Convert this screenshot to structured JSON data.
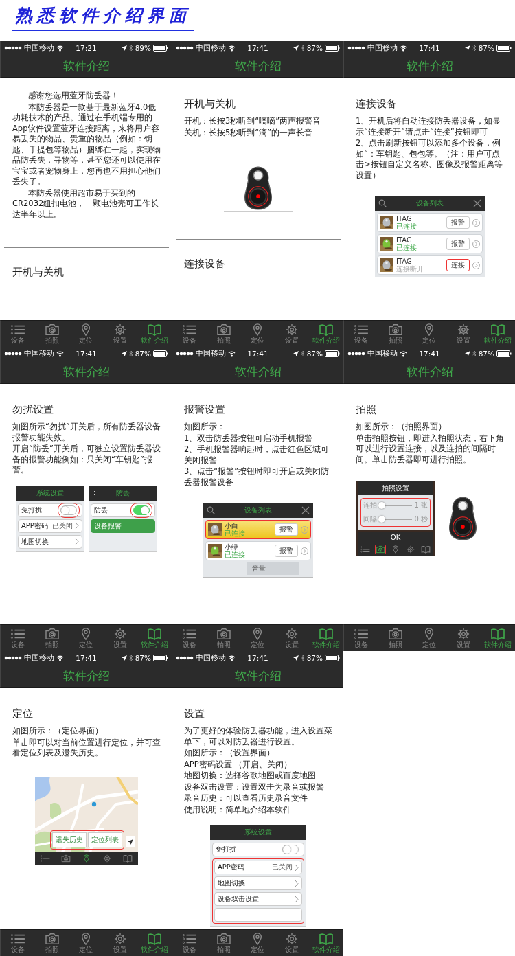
{
  "title": "熟悉软件介绍界面",
  "phones": [
    {
      "carrier": "中国移动",
      "time": "17:21",
      "battery": "89%",
      "header": "软件介绍",
      "blocks": [
        {
          "kind": "para",
          "text": "感谢您选用蓝牙防丢器！"
        },
        {
          "kind": "para",
          "text": "本防丢器是一款基于最新蓝牙4.0低功耗技术的产品。通过在手机端专用的App软件设置蓝牙连接距离，来将用户容易丢失的物品、贵重的物品（例如：钥匙、手提包等物品）捆绑在一起，实现物品防丢失，寻物等，甚至您还可以使用在宝宝或者宠物身上，您再也不用担心他们丢失了。"
        },
        {
          "kind": "para",
          "text": "本防丢器使用超市易于买到的CR2032纽扣电池，一颗电池壳可工作长达半年以上。"
        },
        {
          "kind": "rule"
        },
        {
          "kind": "heading",
          "text": "开机与关机"
        }
      ],
      "tabs": [
        {
          "label": "设备",
          "selected": false
        },
        {
          "label": "拍照",
          "selected": false
        },
        {
          "label": "定位",
          "selected": false
        },
        {
          "label": "设置",
          "selected": false
        },
        {
          "label": "软件介绍",
          "selected": true
        }
      ]
    },
    {
      "carrier": "中国移动",
      "time": "17:41",
      "battery": "87%",
      "header": "软件介绍",
      "blocks": [
        {
          "kind": "heading",
          "text": "开机与关机"
        },
        {
          "kind": "text",
          "text": "开机：长按3秒听到“嘀嘀”两声报警音"
        },
        {
          "kind": "text",
          "text": "关机：长按5秒听到“滴”的一声长音"
        },
        {
          "kind": "tag"
        },
        {
          "kind": "rule"
        },
        {
          "kind": "heading",
          "text": "连接设备"
        }
      ],
      "tabs": [
        {
          "label": "设备",
          "selected": false
        },
        {
          "label": "拍照",
          "selected": false
        },
        {
          "label": "定位",
          "selected": false
        },
        {
          "label": "设置",
          "selected": false
        },
        {
          "label": "软件介绍",
          "selected": true
        }
      ]
    },
    {
      "carrier": "中国移动",
      "time": "17:41",
      "battery": "87%",
      "header": "软件介绍",
      "blocks": [
        {
          "kind": "heading",
          "text": "连接设备"
        },
        {
          "kind": "text",
          "text": "1、开机后将自动连接防丢器设备，如显示“连接断开”请点击“连接”按钮即可"
        },
        {
          "kind": "text",
          "text": "2、点击刷新按钮可以添加多个设备，例如“：车钥匙、包包等。（注：用户可点击>按钮自定义名称、图像及报警距离等设置）"
        },
        {
          "kind": "device_list",
          "title": "设备列表",
          "rows": [
            {
              "name": "ITAG",
              "status": "已连接",
              "action": "报警",
              "connected": true,
              "highlighted": false,
              "action_highlighted": false
            },
            {
              "name": "ITAG",
              "status": "已连接",
              "action": "报警",
              "connected": true,
              "highlighted": false,
              "action_highlighted": false
            },
            {
              "name": "ITAG",
              "status": "连接断开",
              "action": "连接",
              "connected": false,
              "highlighted": false,
              "action_highlighted": true
            }
          ]
        }
      ],
      "tabs": [
        {
          "label": "设备",
          "selected": false
        },
        {
          "label": "拍照",
          "selected": false
        },
        {
          "label": "定位",
          "selected": false
        },
        {
          "label": "设置",
          "selected": false
        },
        {
          "label": "软件介绍",
          "selected": true
        }
      ]
    },
    {
      "carrier": "中国移动",
      "time": "17:41",
      "battery": "87%",
      "header": "软件介绍",
      "blocks": [
        {
          "kind": "heading",
          "text": "勿扰设置"
        },
        {
          "kind": "text",
          "text": "如图所示“勿扰”开关后，所有防丢器设备报警功能失效。"
        },
        {
          "kind": "text",
          "text": "开启“防丢”开关后，可独立设置防丢器设备的报警功能例如：只关闭“车钥匙”报警。"
        },
        {
          "kind": "screens",
          "screens": [
            {
              "title": "系统设置",
              "back": false,
              "rows": [
                {
                  "kind": "toggle",
                  "label": "免打扰",
                  "on": false,
                  "highlighted": true
                },
                {
                  "kind": "link",
                  "label": "APP密码",
                  "value": "已关闭",
                  "highlighted": false
                },
                {
                  "kind": "link",
                  "label": "地图切换",
                  "highlighted": false
                }
              ]
            },
            {
              "title": "防丢",
              "back": true,
              "rows": [
                {
                  "kind": "toggle",
                  "label": "防丢",
                  "on": true,
                  "highlighted": true
                },
                {
                  "kind": "band",
                  "label": "设备报警",
                  "highlighted": false
                }
              ]
            }
          ]
        }
      ],
      "tabs": [
        {
          "label": "设备",
          "selected": false
        },
        {
          "label": "拍照",
          "selected": false
        },
        {
          "label": "定位",
          "selected": false
        },
        {
          "label": "设置",
          "selected": false
        },
        {
          "label": "软件介绍",
          "selected": true
        }
      ]
    },
    {
      "carrier": "中国移动",
      "time": "17:41",
      "battery": "87%",
      "header": "软件介绍",
      "blocks": [
        {
          "kind": "heading",
          "text": "报警设置"
        },
        {
          "kind": "text",
          "text": "如图所示："
        },
        {
          "kind": "text",
          "text": "1、双击防丢器按钮可启动手机报警"
        },
        {
          "kind": "text",
          "text": "2、手机报警器响起时，点击红色区域可关闭报警"
        },
        {
          "kind": "text",
          "text": "3、点击“报警”按钮时即可开启或关闭防丢器报警设备"
        },
        {
          "kind": "device_list",
          "title": "设备列表",
          "footer": "音量",
          "rows": [
            {
              "name": "小白",
              "status": "已连接",
              "action": "报警",
              "connected": true,
              "highlighted": true,
              "action_highlighted": false
            },
            {
              "name": "小绿",
              "status": "已连接",
              "action": "报警",
              "connected": true,
              "highlighted": false,
              "action_highlighted": false
            }
          ]
        }
      ],
      "tabs": [
        {
          "label": "设备",
          "selected": false
        },
        {
          "label": "拍照",
          "selected": false
        },
        {
          "label": "定位",
          "selected": false
        },
        {
          "label": "设置",
          "selected": false
        },
        {
          "label": "软件介绍",
          "selected": true
        }
      ]
    },
    {
      "carrier": "中国移动",
      "time": "17:41",
      "battery": "87%",
      "header": "软件介绍",
      "blocks": [
        {
          "kind": "heading",
          "text": "拍照"
        },
        {
          "kind": "text",
          "text": "如图所示：（拍照界面）"
        },
        {
          "kind": "text",
          "text": "单击拍照按钮，即进入拍照状态，右下角可以进行设置连接，以及连拍的间隔时间。单击防丢器即可进行拍照。"
        },
        {
          "kind": "photo_settings",
          "title": "拍照设置",
          "highlighted": true,
          "button": "OK",
          "sliders": [
            {
              "label": "连拍",
              "level": 0,
              "reading": "1 张"
            },
            {
              "label": "间隔",
              "level": 0,
              "reading": "0 秒"
            }
          ],
          "tabs": [
            {
              "selected": false,
              "highlighted": false
            },
            {
              "selected": true,
              "highlighted": true
            },
            {
              "selected": false,
              "highlighted": false
            },
            {
              "selected": false,
              "highlighted": false
            },
            {
              "selected": false,
              "highlighted": false
            }
          ]
        }
      ],
      "tabs": [
        {
          "label": "设备",
          "selected": false
        },
        {
          "label": "拍照",
          "selected": false
        },
        {
          "label": "定位",
          "selected": false
        },
        {
          "label": "设置",
          "selected": false
        },
        {
          "label": "软件介绍",
          "selected": true
        }
      ]
    },
    {
      "carrier": "中国移动",
      "time": "17:41",
      "battery": "87%",
      "header": "软件介绍",
      "blocks": [
        {
          "kind": "heading",
          "text": "定位"
        },
        {
          "kind": "text",
          "text": "如图所示：（定位界面）"
        },
        {
          "kind": "text",
          "text": "单击即可以对当前位置进行定位，并可查看定位列表及遗失历史。"
        },
        {
          "kind": "map",
          "buttons": [
            "遗失历史",
            "定位列表"
          ],
          "highlighted": true,
          "tabs": [
            {
              "selected": false,
              "highlighted": false
            },
            {
              "selected": false,
              "highlighted": false
            },
            {
              "selected": true,
              "highlighted": false
            },
            {
              "selected": false,
              "highlighted": false
            },
            {
              "selected": false,
              "highlighted": false
            }
          ]
        }
      ],
      "tabs": [
        {
          "label": "设备",
          "selected": false
        },
        {
          "label": "拍照",
          "selected": false
        },
        {
          "label": "定位",
          "selected": false
        },
        {
          "label": "设置",
          "selected": false
        },
        {
          "label": "软件介绍",
          "selected": true
        }
      ]
    },
    {
      "carrier": "中国移动",
      "time": "17:41",
      "battery": "87%",
      "header": "软件介绍",
      "blocks": [
        {
          "kind": "heading",
          "text": "设置"
        },
        {
          "kind": "text",
          "text": "为了更好的体验防丢器功能，进入设置菜单下，可以对防丢器进行设置。"
        },
        {
          "kind": "text",
          "text": "如图所示：（设置界面）"
        },
        {
          "kind": "text",
          "text": "APP密码设置 （开启、关闭）"
        },
        {
          "kind": "text",
          "text": "地图切换：选择谷歌地图或百度地图"
        },
        {
          "kind": "text",
          "text": "设备双击设置：设置双击为录音或报警"
        },
        {
          "kind": "text",
          "text": "录音历史：可以查看历史录音文件"
        },
        {
          "kind": "text",
          "text": "使用说明：简单地介绍本软件"
        },
        {
          "kind": "screens",
          "screens": [
            {
              "title": "系统设置",
              "back": false,
              "rows": [
                {
                  "kind": "toggle",
                  "label": "免打扰",
                  "on": false,
                  "highlighted": false
                },
                {
                  "kind": "link",
                  "label": "APP密码",
                  "value": "已关闭",
                  "highlighted": true
                },
                {
                  "kind": "link",
                  "label": "地图切换",
                  "highlighted": true
                },
                {
                  "kind": "link",
                  "label": "设备双击设置",
                  "highlighted": true
                },
                {
                  "kind": "stub",
                  "highlighted": true
                }
              ]
            }
          ]
        }
      ],
      "tabs": [
        {
          "label": "设备",
          "selected": false
        },
        {
          "label": "拍照",
          "selected": false
        },
        {
          "label": "定位",
          "selected": false
        },
        {
          "label": "设置",
          "selected": false
        },
        {
          "label": "软件介绍",
          "selected": true
        }
      ]
    }
  ]
}
